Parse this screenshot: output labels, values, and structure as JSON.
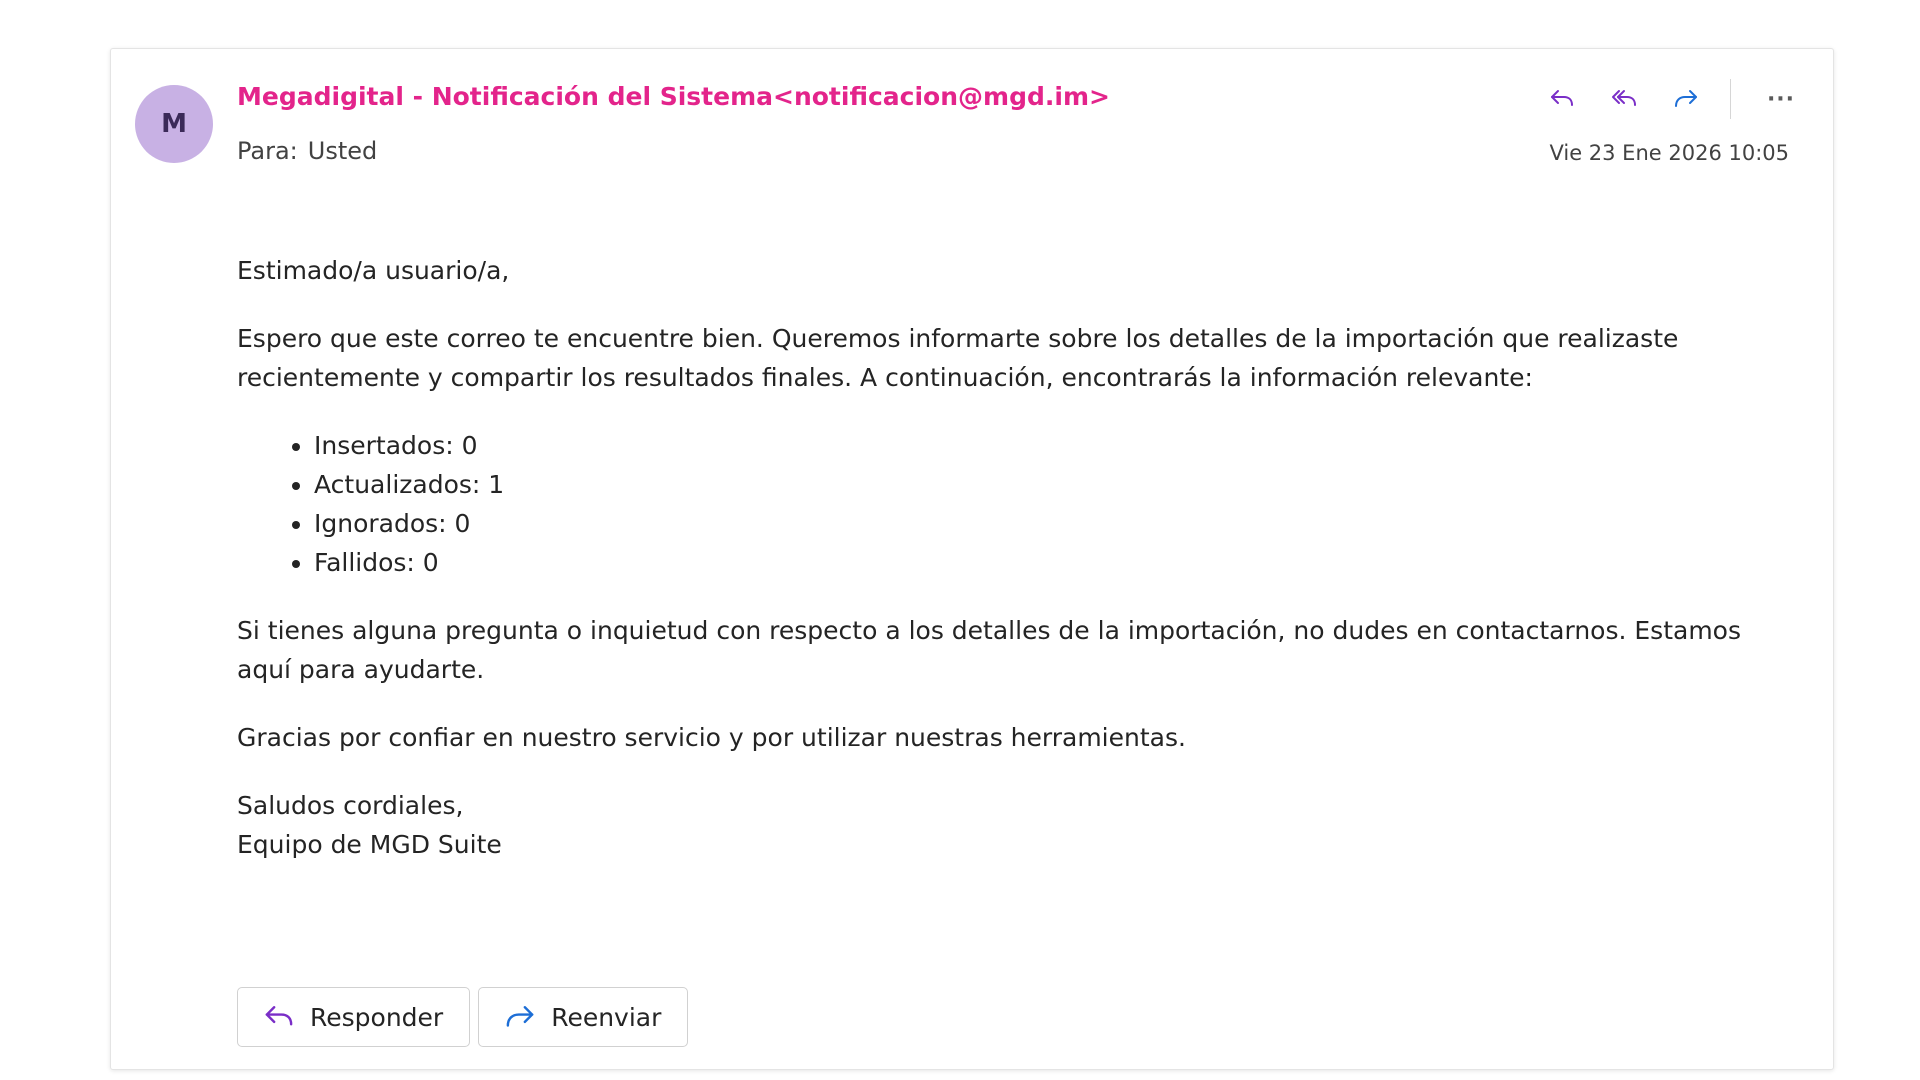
{
  "sender": {
    "avatar_initial": "M",
    "avatar_color": "#c8b1e4",
    "display": "Megadigital - Notificación del Sistema<notificacion@mgd.im>",
    "color": "#e3248b"
  },
  "recipient": {
    "label": "Para:",
    "value": "Usted"
  },
  "date": "Vie 23 Ene 2026 10:05",
  "toolbar": {
    "reply_icon": "reply-icon",
    "reply_all_icon": "reply-all-icon",
    "forward_icon": "forward-icon",
    "more_label": "···",
    "accent_color": "#7a2ec7"
  },
  "message": {
    "greeting": "Estimado/a usuario/a,",
    "intro": "Espero que este correo te encuentre bien. Queremos informarte sobre los detalles de la importación que realizaste recientemente y compartir los resultados finales. A continuación, encontrarás la información relevante:",
    "results": [
      "Insertados: 0",
      "Actualizados: 1",
      "Ignorados: 0",
      "Fallidos: 0"
    ],
    "help": "Si tienes alguna pregunta o inquietud con respecto a los detalles de la importación, no dudes en contactarnos. Estamos aquí para ayudarte.",
    "thanks": "Gracias por confiar en nuestro servicio y por utilizar nuestras herramientas.",
    "closing": "Saludos cordiales,",
    "signature": "Equipo de MGD Suite"
  },
  "buttons": {
    "reply_label": "Responder",
    "forward_label": "Reenviar"
  }
}
